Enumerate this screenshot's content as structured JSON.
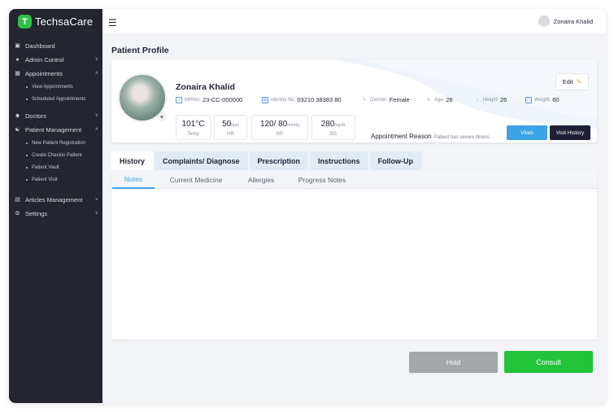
{
  "app": {
    "name": "TechsaCare",
    "logo_letter": "T",
    "brand_color": "#2fbf4a",
    "sidebar_color": "#23252f"
  },
  "sidebar": {
    "items": [
      {
        "label": "Dashboard",
        "icon": "dashboard-icon"
      },
      {
        "label": "Admin Control",
        "icon": "admin-icon"
      },
      {
        "label": "Appointments",
        "icon": "calendar-icon"
      },
      {
        "label": "Doctors",
        "icon": "doctor-icon"
      },
      {
        "label": "Patient Management",
        "icon": "patient-icon"
      },
      {
        "label": "Articles Management",
        "icon": "articles-icon"
      },
      {
        "label": "Settings",
        "icon": "gear-icon"
      }
    ],
    "appointments_sub": [
      "View Appointments",
      "Scheduled Appointments"
    ],
    "patient_sub": [
      "New Patient Registration",
      "Create Checkin Patient",
      "Patient Vault",
      "Patient Visit"
    ]
  },
  "topbar": {
    "user_name": "Zonaira Khalid"
  },
  "page": {
    "title": "Patient Profile"
  },
  "patient": {
    "name": "Zonaira Khalid",
    "mrno_label": "MRNO:",
    "mrno": "23-CC-000000",
    "identity_label": "Identity No:",
    "identity": "03210 38383 80",
    "gender_label": "Gender:",
    "gender": "Female",
    "age_label": "Age:",
    "age": "26",
    "height_label": "Height:",
    "height": "26",
    "weight_label": "Weight:",
    "weight": "60"
  },
  "vitals": [
    {
      "value": "101°C",
      "unit": "",
      "label": "Temp"
    },
    {
      "value": "50",
      "unit": "bpm",
      "label": "HR"
    },
    {
      "value": "120/ 80",
      "unit": "mmHg",
      "label": "BP"
    },
    {
      "value": "280",
      "unit": "mg/dL",
      "label": "BS"
    }
  ],
  "appointment": {
    "label": "Appointment Reason",
    "value": "Patient has severe illness."
  },
  "buttons": {
    "edit": "Edit",
    "vitals": "Vitals",
    "visit_history": "Visit History",
    "hold": "Hold",
    "consult": "Consult"
  },
  "tabs": [
    "History",
    "Complaints/ Diagnose",
    "Prescription",
    "Instructions",
    "Follow-Up"
  ],
  "subtabs": [
    "Notes",
    "Current Medicine",
    "Allergies",
    "Progress Notes"
  ],
  "colors": {
    "accent": "#3ba3e6",
    "consult": "#22c33a",
    "hold": "#a4a6aa",
    "dark_button": "#1d2038"
  }
}
